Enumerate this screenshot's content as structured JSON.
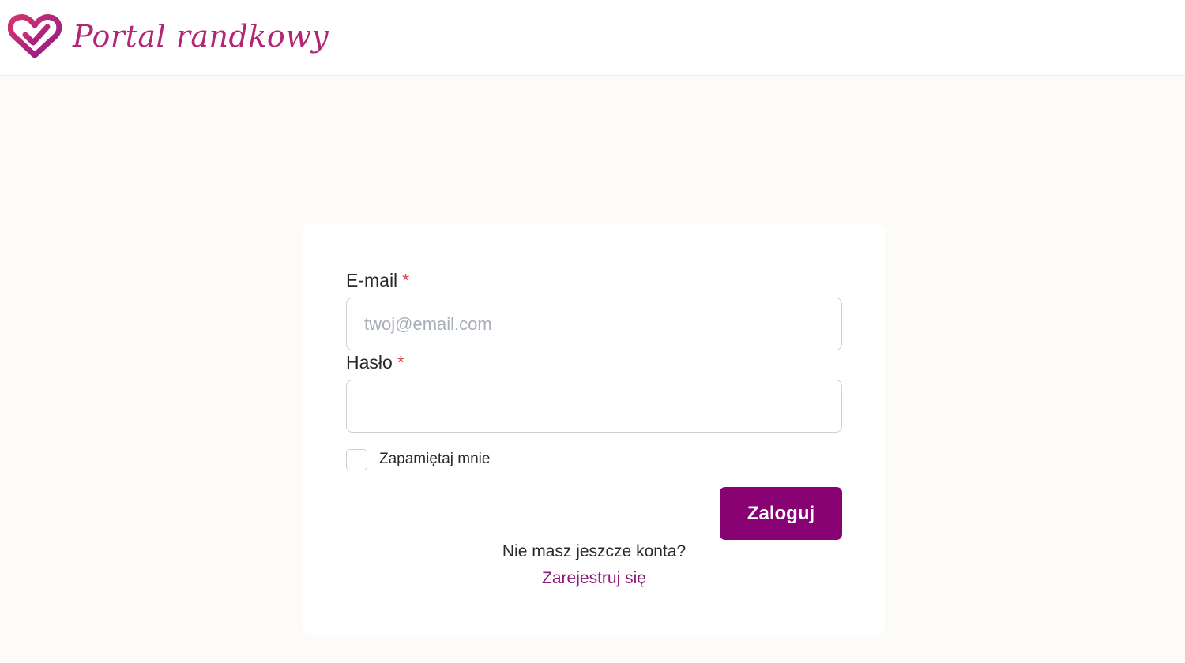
{
  "header": {
    "logo_text": "Portal randkowy",
    "logo_icon": "heart-logo-icon"
  },
  "login_form": {
    "email_label": "E-mail",
    "email_required_mark": "*",
    "email_placeholder": "twoj@email.com",
    "email_value": "",
    "password_label": "Hasło",
    "password_required_mark": "*",
    "password_value": "",
    "remember_me_label": "Zapamiętaj mnie",
    "remember_me_checked": false,
    "submit_label": "Zaloguj",
    "no_account_text": "Nie masz jeszcze konta?",
    "register_link_label": "Zarejestruj się"
  },
  "colors": {
    "brand": "#880273",
    "logo_pink": "#b42673",
    "required_red": "#e0454f",
    "page_background": "#fdfbf8"
  }
}
